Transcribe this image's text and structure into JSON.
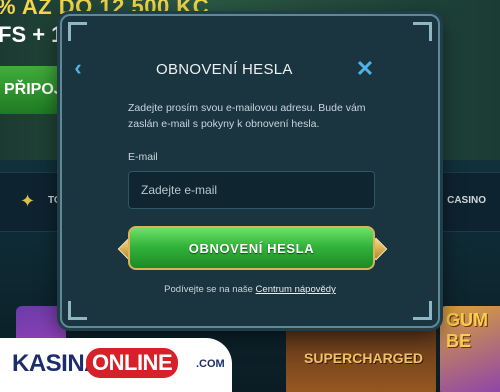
{
  "background": {
    "promo_line1": "% AŽ DO 12 500 KČ",
    "promo_line2": "FS + 1",
    "partial_button": "PŘIPOJ",
    "nav_right": "CASINO",
    "nav_left": "TO",
    "tile_right": "GUM BE",
    "tile_center": "SUPERCHARGED"
  },
  "modal": {
    "title": "OBNOVENÍ HESLA",
    "back_icon": "chevron-left-icon",
    "close_icon": "close-icon",
    "description": "Zadejte prosím svou e-mailovou adresu. Bude vám zaslán e-mail s pokyny k obnovení hesla.",
    "email_label": "E-mail",
    "email_placeholder": "Zadejte e-mail",
    "email_value": "",
    "submit_label": "OBNOVENÍ HESLA",
    "help_text": "Podívejte se na naše",
    "help_link": "Centrum nápovědy"
  },
  "watermark": {
    "logo_text": "KASINAONLINE.COM"
  },
  "colors": {
    "accent": "#4fb3e6",
    "button_green": "#33b43a",
    "modal_bg": "#1a3440"
  }
}
